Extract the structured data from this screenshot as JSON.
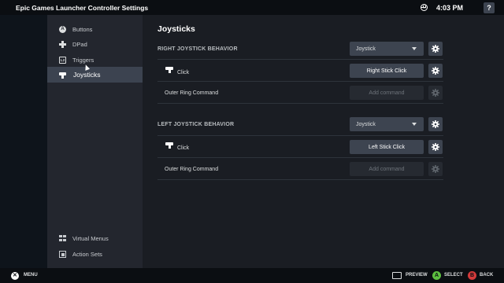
{
  "window": {
    "title": "Epic Games Launcher Controller Settings",
    "clock": "4:03 PM",
    "help_label": "?"
  },
  "sidebar": {
    "items": [
      {
        "label": "Buttons",
        "icon": "a-button-icon"
      },
      {
        "label": "DPad",
        "icon": "dpad-icon"
      },
      {
        "label": "Triggers",
        "icon": "l2-trigger-icon",
        "icon_text": "L2"
      },
      {
        "label": "Joysticks",
        "icon": "joystick-icon",
        "active": true
      }
    ],
    "bottom_items": [
      {
        "label": "Virtual Menus",
        "icon": "grid-icon"
      },
      {
        "label": "Action Sets",
        "icon": "action-sets-icon"
      }
    ],
    "a_icon_text": "A"
  },
  "main": {
    "title": "Joysticks",
    "right": {
      "heading": "RIGHT JOYSTICK BEHAVIOR",
      "behavior_value": "Joystick",
      "click_label": "Click",
      "click_command": "Right Stick Click",
      "outer_ring_label": "Outer Ring Command",
      "outer_ring_command": "Add command"
    },
    "left": {
      "heading": "LEFT JOYSTICK BEHAVIOR",
      "behavior_value": "Joystick",
      "click_label": "Click",
      "click_command": "Left Stick Click",
      "outer_ring_label": "Outer Ring Command",
      "outer_ring_command": "Add command"
    }
  },
  "footer": {
    "menu_label": "MENU",
    "preview_label": "PREVIEW",
    "select_label": "SELECT",
    "select_key": "A",
    "back_label": "BACK",
    "back_key": "B"
  },
  "colors": {
    "accent_select": "#5cbf3f",
    "accent_back": "#d33a3a",
    "sidebar_active": "#3c4350"
  }
}
